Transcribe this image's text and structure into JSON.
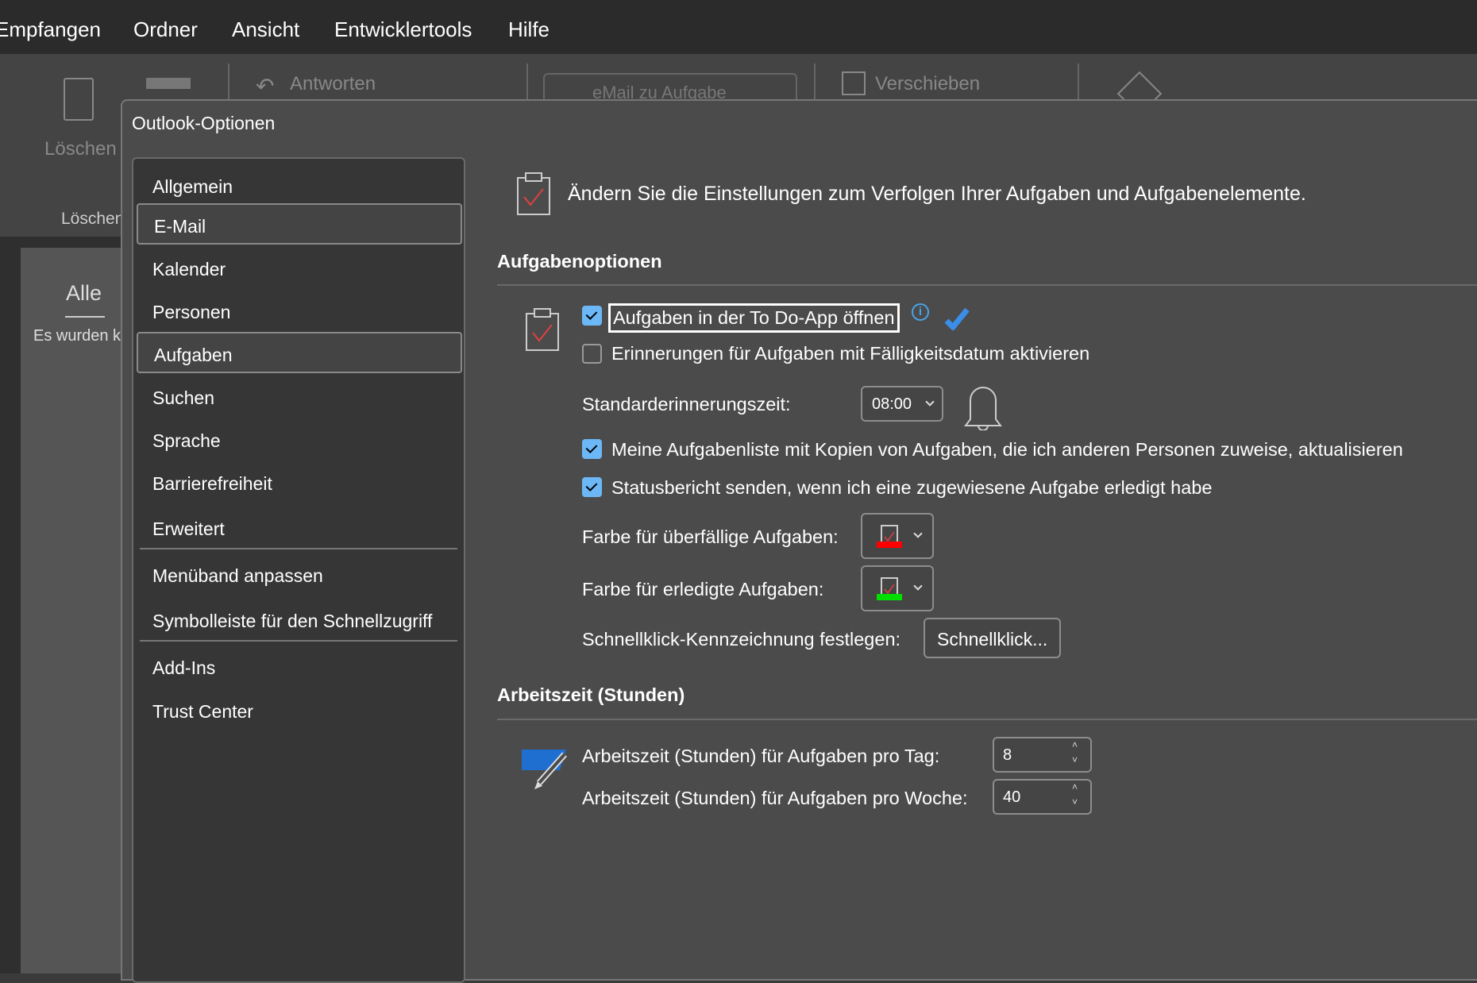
{
  "menubar": {
    "items": [
      "Empfangen",
      "Ordner",
      "Ansicht",
      "Entwicklertools",
      "Hilfe"
    ]
  },
  "ribbon": {
    "delete_label": "Löschen",
    "delete_group": "Löschen",
    "reply_label": "Antworten",
    "email_task_label": "eMail zu Aufgabe",
    "move_label": "Verschieben"
  },
  "mailpane": {
    "filter_all": "Alle",
    "empty_text": "Es wurden k"
  },
  "dialog": {
    "title": "Outlook-Optionen",
    "nav": [
      "Allgemein",
      "E-Mail",
      "Kalender",
      "Personen",
      "Aufgaben",
      "Suchen",
      "Sprache",
      "Barrierefreiheit",
      "Erweitert",
      "Menüband anpassen",
      "Symbolleiste für den Schnellzugriff",
      "Add-Ins",
      "Trust Center"
    ],
    "selected_nav": "Aufgaben",
    "intro": "Ändern Sie die Einstellungen zum Verfolgen Ihrer Aufgaben und Aufgabenelemente.",
    "task_options": {
      "heading": "Aufgabenoptionen",
      "open_todo": {
        "label": "Aufgaben in der To Do-App öffnen",
        "checked": true
      },
      "reminders": {
        "label": "Erinnerungen für Aufgaben mit Fälligkeitsdatum aktivieren",
        "checked": false
      },
      "default_reminder_label": "Standarderinnerungszeit:",
      "default_reminder_value": "08:00",
      "update_list": {
        "label": "Meine Aufgabenliste mit Kopien von Aufgaben, die ich anderen Personen zuweise, aktualisieren",
        "checked": true
      },
      "status_report": {
        "label": "Statusbericht senden, wenn ich eine zugewiesene Aufgabe erledigt habe",
        "checked": true
      },
      "overdue_color_label": "Farbe für überfällige Aufgaben:",
      "overdue_color": "#ff0000",
      "completed_color_label": "Farbe für erledigte Aufgaben:",
      "completed_color": "#00e000",
      "quickclick_label": "Schnellklick-Kennzeichnung festlegen:",
      "quickclick_button": "Schnellklick..."
    },
    "work_hours": {
      "heading": "Arbeitszeit (Stunden)",
      "per_day_label": "Arbeitszeit (Stunden) für Aufgaben pro Tag:",
      "per_day_value": "8",
      "per_week_label": "Arbeitszeit (Stunden) für Aufgaben pro Woche:",
      "per_week_value": "40"
    }
  }
}
